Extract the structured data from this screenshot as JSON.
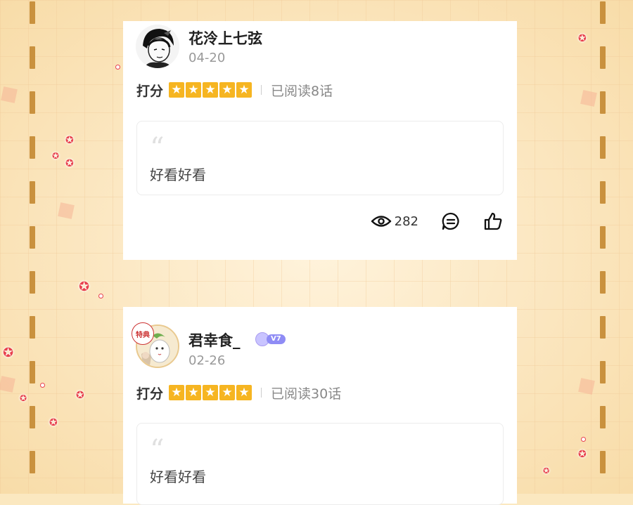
{
  "theme": {
    "star_color": "#f6b521",
    "strip_color": "#c9913e",
    "bg": "#fbe8c0"
  },
  "comments": [
    {
      "username": "花泠上七弦",
      "date": "04-20",
      "rating_label": "打分",
      "stars": 5,
      "read_count": "已阅读8话",
      "quote_mark": "“",
      "text": "好看好看",
      "views": "282",
      "avatar_icon": "avatar-illustration-icon"
    },
    {
      "username": "君幸食_",
      "date": "02-26",
      "rating_label": "打分",
      "stars": 5,
      "read_count": "已阅读30话",
      "quote_mark": "“",
      "text": "好看好看",
      "vip_badge": "V7",
      "avatar_badge": "特典",
      "avatar_icon": "avatar-illustration-icon"
    }
  ]
}
